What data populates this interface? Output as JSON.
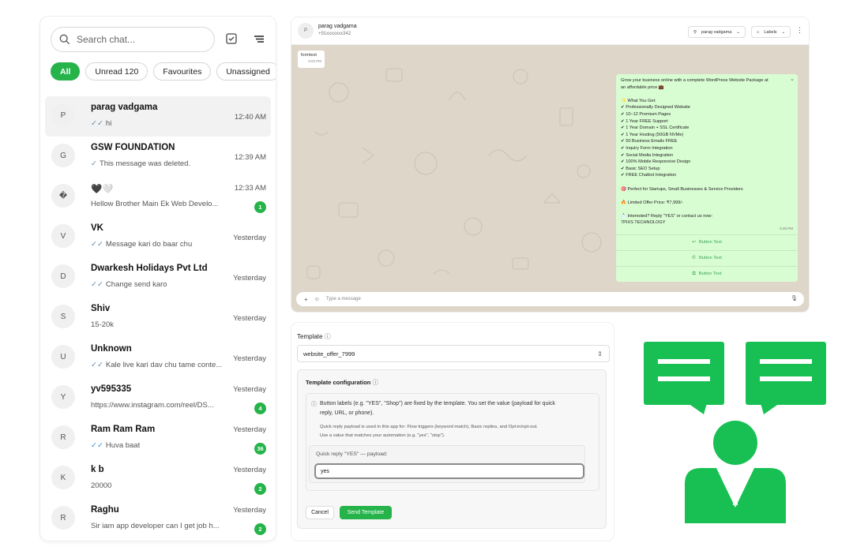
{
  "sidebar": {
    "search_placeholder": "Search chat...",
    "filters": [
      "All",
      "Unread 120",
      "Favourites",
      "Unassigned"
    ],
    "chats": [
      {
        "avatar": "P",
        "name": "parag vadgama",
        "preview": "hi",
        "time": "12:40 AM",
        "badge": "",
        "tick": "double"
      },
      {
        "avatar": "G",
        "name": "GSW FOUNDATION",
        "preview": "This message was deleted.",
        "time": "12:39 AM",
        "badge": "",
        "tick": "single"
      },
      {
        "avatar": "�",
        "name": "🖤🤍",
        "preview": "Hellow Brother Main Ek Web Develo...",
        "time": "12:33 AM",
        "badge": "1",
        "tick": ""
      },
      {
        "avatar": "V",
        "name": "VK",
        "preview": "Message kari do baar chu",
        "time": "Yesterday",
        "badge": "",
        "tick": "double"
      },
      {
        "avatar": "D",
        "name": "Dwarkesh Holidays Pvt Ltd",
        "preview": "Change send karo",
        "time": "Yesterday",
        "badge": "",
        "tick": "double"
      },
      {
        "avatar": "S",
        "name": "Shiv",
        "preview": "15-20k",
        "time": "Yesterday",
        "badge": "",
        "tick": ""
      },
      {
        "avatar": "U",
        "name": "Unknown",
        "preview": "Kale live kari dav chu tame conte...",
        "time": "Yesterday",
        "badge": "",
        "tick": "double"
      },
      {
        "avatar": "Y",
        "name": "yv595335",
        "preview": "https://www.instagram.com/reel/DS...",
        "time": "Yesterday",
        "badge": "4",
        "tick": ""
      },
      {
        "avatar": "R",
        "name": "Ram Ram Ram",
        "preview": "Huva baat",
        "time": "Yesterday",
        "badge": "36",
        "tick": "double-blue"
      },
      {
        "avatar": "K",
        "name": "k b",
        "preview": "20000",
        "time": "Yesterday",
        "badge": "2",
        "tick": ""
      },
      {
        "avatar": "R",
        "name": "Raghu",
        "preview": "Sir iam app developer can I get job h...",
        "time": "Yesterday",
        "badge": "2",
        "tick": ""
      }
    ]
  },
  "chat": {
    "contact_avatar": "P",
    "contact_name": "parag vadgama",
    "contact_phone": "+91xxxxxxx342",
    "assignee": "parag vadgama",
    "labels_label": "Labels",
    "incoming_text": "formtest",
    "incoming_time": "6:03 PM",
    "outgoing": {
      "lines": [
        "Grow your business online with a complete WordPress Website Package at",
        "an affordable price 💼",
        "",
        "✨ What You Get:",
        "✔ Professionally Designed Website",
        "✔ 10–12 Premium Pages",
        "✔ 1 Year FREE Support",
        "✔ 1 Year Domain + SSL Certificate",
        "✔ 1 Year Hosting (50GB NVMe)",
        "✔ 50 Business Emails FREE",
        "✔ Inquiry Form Integration",
        "✔ Social Media Integration",
        "✔ 100% Mobile Responsive Design",
        "✔ Basic SEO Setup",
        "✔ FREE Chatbot Integration",
        "",
        "🎯 Perfect for Startups, Small Businesses & Service Providers",
        "",
        "🔥 Limited Offer Price: ₹7,999/-",
        "",
        "📩 Interested? Reply \"YES\" or contact us now:",
        "7PIXS TECHNOLOGY"
      ],
      "time": "5:35 PM",
      "buttons": [
        "Button Text",
        "Button Text",
        "Button Text"
      ]
    },
    "composer_placeholder": "Type a message"
  },
  "template": {
    "label": "Template",
    "selected": "website_offer_7999",
    "config_title": "Template configuration",
    "info_line1": "Button labels (e.g. \"YES\", \"Shop\") are fixed by the template. You set the value (payload for quick",
    "info_line2": "reply, URL, or phone).",
    "info_small1": "Quick reply payload is used in this app for: Flow triggers (keyword match), Basic replies, and Opt-in/opt-out.",
    "info_small2": "Use a value that matches your automation (e.g. \"yes\", \"stop\").",
    "field_label": "Quick reply \"YES\" — payload:",
    "field_value": "yes",
    "cancel_label": "Cancel",
    "send_label": "Send Template"
  },
  "colors": {
    "accent": "#25b34a",
    "bubble": "#d9fdd3",
    "wallpaper": "#ddd6c9"
  }
}
